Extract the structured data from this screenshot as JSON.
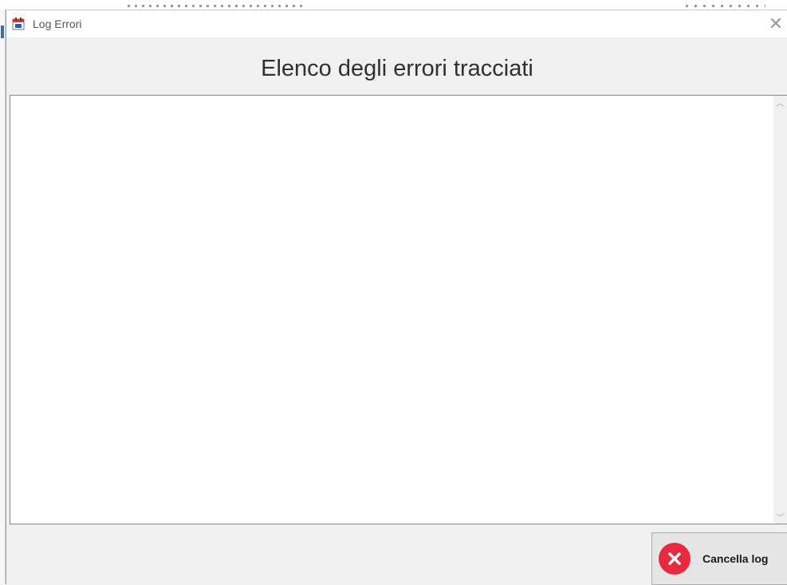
{
  "window": {
    "title": "Log Errori",
    "close_glyph": "✕",
    "app_icon": "calendar-icon"
  },
  "main": {
    "heading": "Elenco degli errori tracciati",
    "log_text": ""
  },
  "scrollbar": {
    "up_glyph": "︿",
    "down_glyph": "﹀"
  },
  "footer": {
    "clear_log_label": "Cancella log",
    "clear_log_icon": "close-circle-icon",
    "icon_color": "#e8293e"
  }
}
